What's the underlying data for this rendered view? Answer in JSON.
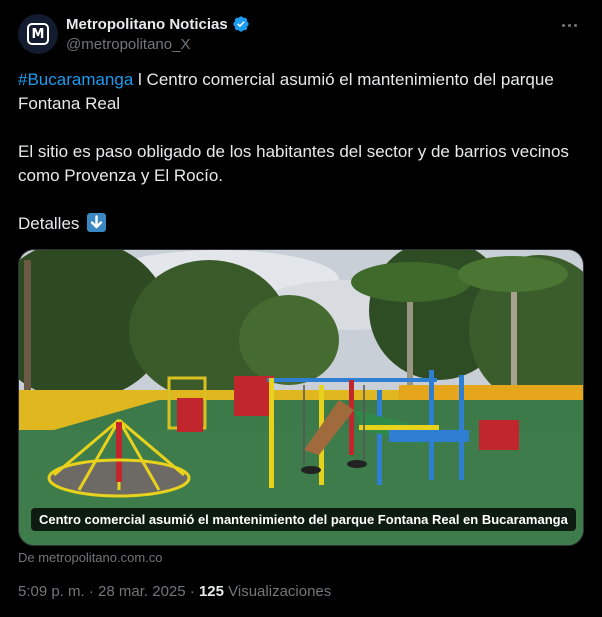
{
  "author": {
    "name": "Metropolitano Noticias",
    "handle": "@metropolitano_X",
    "avatar_letter": "M",
    "verified": true
  },
  "tweet": {
    "hashtag": "#Bucaramanga",
    "line1_rest": " l Centro comercial asumió el mantenimiento del parque Fontana Real",
    "paragraph2": "El sitio es paso obligado de los habitantes del sector y de barrios vecinos como Provenza y El Rocío.",
    "details_label": "Detalles",
    "details_emoji": "down-arrow-emoji"
  },
  "media": {
    "caption": "Centro comercial asumió el mantenimiento del parque Fontana Real en Bucaramanga",
    "source": "De metropolitano.com.co"
  },
  "meta": {
    "time": "5:09 p. m.",
    "separator": " · ",
    "date": "28 mar. 2025",
    "views_count": "125",
    "views_label": " Visualizaciones"
  },
  "colors": {
    "background": "#000000",
    "text": "#e7e9ea",
    "muted": "#71767b",
    "link": "#1d9bf0",
    "verified": "#1d9bf0"
  },
  "icons": [
    "verified-badge-icon",
    "more-options-icon",
    "down-arrow-emoji"
  ]
}
